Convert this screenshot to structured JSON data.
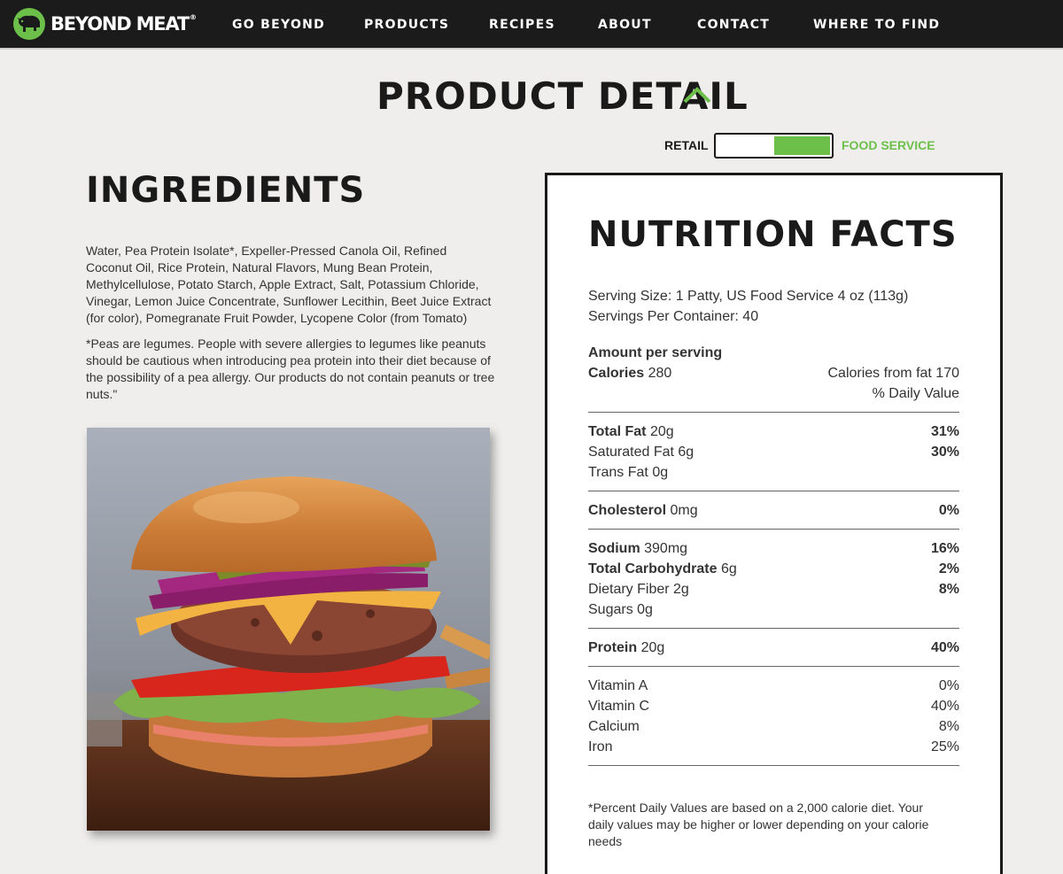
{
  "brand": {
    "name": "BEYOND MEAT",
    "mark": "®"
  },
  "nav": {
    "items": [
      {
        "label": "GO BEYOND"
      },
      {
        "label": "PRODUCTS"
      },
      {
        "label": "RECIPES"
      },
      {
        "label": "ABOUT"
      },
      {
        "label": "CONTACT"
      },
      {
        "label": "WHERE TO FIND"
      }
    ]
  },
  "header": {
    "title": "PRODUCT DETAIL",
    "collapse_icon": "chevron-up-icon"
  },
  "toggle": {
    "left_label": "RETAIL",
    "right_label": "FOOD SERVICE",
    "selected": "FOOD SERVICE",
    "accent": "#6cc04a"
  },
  "ingredients": {
    "title": "INGREDIENTS",
    "text": "Water, Pea Protein Isolate*, Expeller-Pressed Canola Oil, Refined Coconut Oil, Rice Protein, Natural Flavors, Mung Bean Protein, Methylcellulose, Potato Starch, Apple Extract, Salt, Potassium Chloride, Vinegar, Lemon Juice Concentrate, Sunflower Lecithin, Beet Juice Extract (for color), Pomegranate Fruit Powder, Lycopene Color (from Tomato)",
    "note": "*Peas are legumes. People with severe allergies to legumes like peanuts should be cautious when introducing pea protein into their diet because of the possibility of a pea allergy. Our products do not contain peanuts or tree nuts.\""
  },
  "nutrition": {
    "title": "NUTRITION FACTS",
    "serving_size": "Serving Size: 1 Patty, US Food Service 4 oz (113g)",
    "servings_per_container": "Servings Per Container: 40",
    "amount_per_serving": "Amount per serving",
    "calories_label": "Calories",
    "calories_value": "280",
    "calories_from_fat": "Calories from fat 170",
    "daily_value_header": "% Daily Value",
    "total_fat": {
      "label": "Total Fat",
      "amount": "20g",
      "dv": "31%"
    },
    "saturated_fat": {
      "label": "Saturated Fat",
      "amount": "6g",
      "dv": "30%"
    },
    "trans_fat": {
      "label": "Trans Fat",
      "amount": "0g"
    },
    "cholesterol": {
      "label": "Cholesterol",
      "amount": "0mg",
      "dv": "0%"
    },
    "sodium": {
      "label": "Sodium",
      "amount": "390mg",
      "dv": "16%"
    },
    "total_carbs": {
      "label": "Total Carbohydrate",
      "amount": "6g",
      "dv": "2%"
    },
    "dietary_fiber": {
      "label": "Dietary Fiber",
      "amount": "2g",
      "dv": "8%"
    },
    "sugars": {
      "label": "Sugars",
      "amount": "0g"
    },
    "protein": {
      "label": "Protein",
      "amount": "20g",
      "dv": "40%"
    },
    "vitamins": [
      {
        "label": "Vitamin A",
        "dv": "0%"
      },
      {
        "label": "Vitamin C",
        "dv": "40%"
      },
      {
        "label": "Calcium",
        "dv": "8%"
      },
      {
        "label": "Iron",
        "dv": "25%"
      }
    ],
    "footnote": "*Percent Daily Values are based on a 2,000 calorie diet. Your daily values may be higher or lower depending on your calorie needs"
  }
}
